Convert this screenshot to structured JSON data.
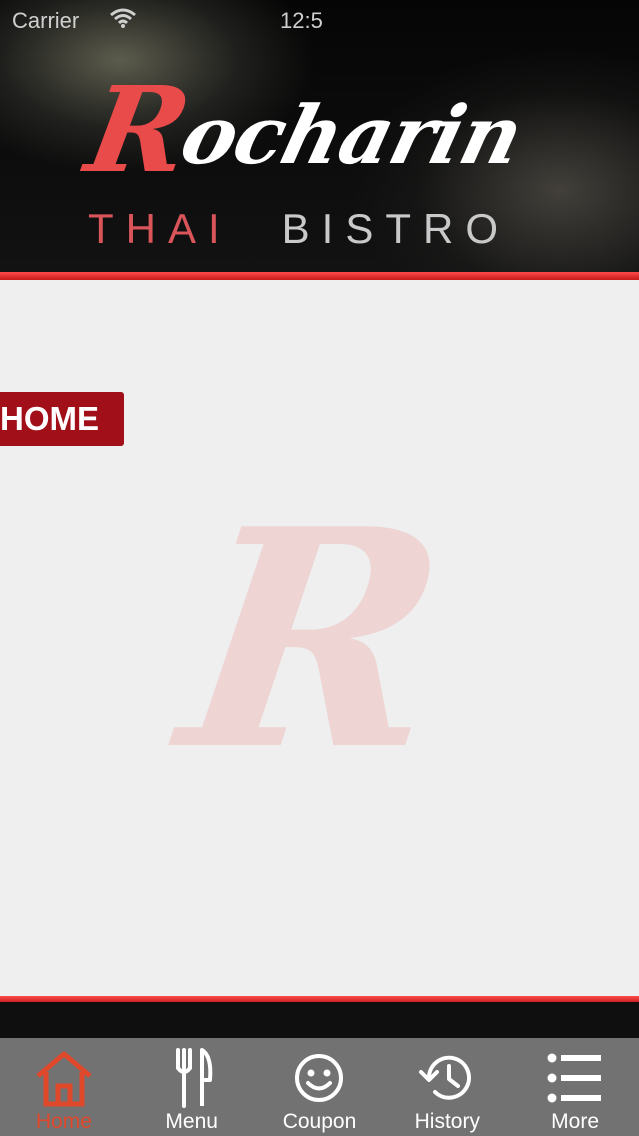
{
  "status_bar": {
    "carrier": "Carrier",
    "time": "12:5"
  },
  "logo": {
    "script_r": "R",
    "script_rest": "ocharin",
    "subtitle_left": "THAI",
    "subtitle_right": "BISTRO"
  },
  "page": {
    "section_label": "HOME",
    "watermark": "R"
  },
  "tabs": [
    {
      "label": "Home",
      "icon": "home-icon",
      "active": true
    },
    {
      "label": "Menu",
      "icon": "fork-knife-icon",
      "active": false
    },
    {
      "label": "Coupon",
      "icon": "smiley-icon",
      "active": false
    },
    {
      "label": "History",
      "icon": "history-icon",
      "active": false
    },
    {
      "label": "More",
      "icon": "list-icon",
      "active": false
    }
  ],
  "colors": {
    "accent_red": "#e94a4a",
    "tag_red": "#a10f18",
    "active_tab": "#e0482b",
    "tabbar_bg": "#727272"
  }
}
